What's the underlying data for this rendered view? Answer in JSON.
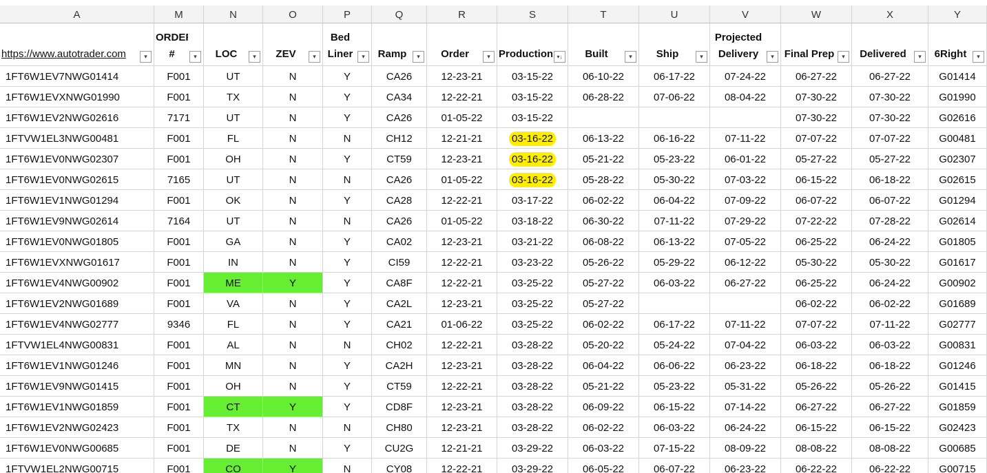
{
  "column_letters": [
    "A",
    "M",
    "N",
    "O",
    "P",
    "Q",
    "R",
    "S",
    "T",
    "U",
    "V",
    "W",
    "X",
    "Y"
  ],
  "headers": [
    "https://www.autotrader.com",
    "ORDER\n#",
    "LOC",
    "ZEV",
    "Bed\nLiner",
    "Ramp",
    "Order",
    "Production",
    "Built",
    "Ship",
    "Projected\nDelivery",
    "Final Prep",
    "Delivered",
    "6Right"
  ],
  "filter_icons": [
    "filter-dropdown-icon",
    "sort-filter-icon"
  ],
  "rows": [
    {
      "vin": "1FT6W1EV7NWG01414",
      "order_num": "F001",
      "loc": "UT",
      "zev": "N",
      "bed": "Y",
      "ramp": "CA26",
      "order": "12-23-21",
      "production": "03-15-22",
      "built": "06-10-22",
      "ship": "06-17-22",
      "projected": "07-24-22",
      "final_prep": "06-27-22",
      "delivered": "06-27-22",
      "right6": "G01414"
    },
    {
      "vin": "1FT6W1EVXNWG01990",
      "order_num": "F001",
      "loc": "TX",
      "zev": "N",
      "bed": "Y",
      "ramp": "CA34",
      "order": "12-22-21",
      "production": "03-15-22",
      "built": "06-28-22",
      "ship": "07-06-22",
      "projected": "08-04-22",
      "final_prep": "07-30-22",
      "delivered": "07-30-22",
      "right6": "G01990"
    },
    {
      "vin": "1FT6W1EV2NWG02616",
      "order_num": "7171",
      "loc": "UT",
      "zev": "N",
      "bed": "Y",
      "ramp": "CA26",
      "order": "01-05-22",
      "production": "03-15-22",
      "built": "",
      "ship": "",
      "projected": "",
      "final_prep": "07-30-22",
      "delivered": "07-30-22",
      "right6": "G02616"
    },
    {
      "vin": "1FTVW1EL3NWG00481",
      "order_num": "F001",
      "loc": "FL",
      "zev": "N",
      "bed": "N",
      "ramp": "CH12",
      "order": "12-21-21",
      "production": "03-16-22",
      "built": "06-13-22",
      "ship": "06-16-22",
      "projected": "07-11-22",
      "final_prep": "07-07-22",
      "delivered": "07-07-22",
      "right6": "G00481",
      "hl_production": true
    },
    {
      "vin": "1FT6W1EV0NWG02307",
      "order_num": "F001",
      "loc": "OH",
      "zev": "N",
      "bed": "Y",
      "ramp": "CT59",
      "order": "12-23-21",
      "production": "03-16-22",
      "built": "05-21-22",
      "ship": "05-23-22",
      "projected": "06-01-22",
      "final_prep": "05-27-22",
      "delivered": "05-27-22",
      "right6": "G02307",
      "hl_production": true
    },
    {
      "vin": "1FT6W1EV0NWG02615",
      "order_num": "7165",
      "loc": "UT",
      "zev": "N",
      "bed": "N",
      "ramp": "CA26",
      "order": "01-05-22",
      "production": "03-16-22",
      "built": "05-28-22",
      "ship": "05-30-22",
      "projected": "07-03-22",
      "final_prep": "06-15-22",
      "delivered": "06-18-22",
      "right6": "G02615",
      "hl_production": true
    },
    {
      "vin": "1FT6W1EV1NWG01294",
      "order_num": "F001",
      "loc": "OK",
      "zev": "N",
      "bed": "Y",
      "ramp": "CA28",
      "order": "12-22-21",
      "production": "03-17-22",
      "built": "06-02-22",
      "ship": "06-04-22",
      "projected": "07-09-22",
      "final_prep": "06-07-22",
      "delivered": "06-07-22",
      "right6": "G01294"
    },
    {
      "vin": "1FT6W1EV9NWG02614",
      "order_num": "7164",
      "loc": "UT",
      "zev": "N",
      "bed": "N",
      "ramp": "CA26",
      "order": "01-05-22",
      "production": "03-18-22",
      "built": "06-30-22",
      "ship": "07-11-22",
      "projected": "07-29-22",
      "final_prep": "07-22-22",
      "delivered": "07-28-22",
      "right6": "G02614"
    },
    {
      "vin": "1FT6W1EV0NWG01805",
      "order_num": "F001",
      "loc": "GA",
      "zev": "N",
      "bed": "Y",
      "ramp": "CA02",
      "order": "12-23-21",
      "production": "03-21-22",
      "built": "06-08-22",
      "ship": "06-13-22",
      "projected": "07-05-22",
      "final_prep": "06-25-22",
      "delivered": "06-24-22",
      "right6": "G01805"
    },
    {
      "vin": "1FT6W1EVXNWG01617",
      "order_num": "F001",
      "loc": "IN",
      "zev": "N",
      "bed": "Y",
      "ramp": "CI59",
      "order": "12-22-21",
      "production": "03-23-22",
      "built": "05-26-22",
      "ship": "05-29-22",
      "projected": "06-12-22",
      "final_prep": "05-30-22",
      "delivered": "05-30-22",
      "right6": "G01617"
    },
    {
      "vin": "1FT6W1EV4NWG00902",
      "order_num": "F001",
      "loc": "ME",
      "zev": "Y",
      "bed": "Y",
      "ramp": "CA8F",
      "order": "12-22-21",
      "production": "03-25-22",
      "built": "05-27-22",
      "ship": "06-03-22",
      "projected": "06-27-22",
      "final_prep": "06-25-22",
      "delivered": "06-24-22",
      "right6": "G00902",
      "green": true
    },
    {
      "vin": "1FT6W1EV2NWG01689",
      "order_num": "F001",
      "loc": "VA",
      "zev": "N",
      "bed": "Y",
      "ramp": "CA2L",
      "order": "12-23-21",
      "production": "03-25-22",
      "built": "05-27-22",
      "ship": "",
      "projected": "",
      "final_prep": "06-02-22",
      "delivered": "06-02-22",
      "right6": "G01689"
    },
    {
      "vin": "1FT6W1EV4NWG02777",
      "order_num": "9346",
      "loc": "FL",
      "zev": "N",
      "bed": "Y",
      "ramp": "CA21",
      "order": "01-06-22",
      "production": "03-25-22",
      "built": "06-02-22",
      "ship": "06-17-22",
      "projected": "07-11-22",
      "final_prep": "07-07-22",
      "delivered": "07-11-22",
      "right6": "G02777"
    },
    {
      "vin": "1FTVW1EL4NWG00831",
      "order_num": "F001",
      "loc": "AL",
      "zev": "N",
      "bed": "N",
      "ramp": "CH02",
      "order": "12-22-21",
      "production": "03-28-22",
      "built": "05-20-22",
      "ship": "05-24-22",
      "projected": "07-04-22",
      "final_prep": "06-03-22",
      "delivered": "06-03-22",
      "right6": "G00831"
    },
    {
      "vin": "1FT6W1EV1NWG01246",
      "order_num": "F001",
      "loc": "MN",
      "zev": "N",
      "bed": "Y",
      "ramp": "CA2H",
      "order": "12-23-21",
      "production": "03-28-22",
      "built": "06-04-22",
      "ship": "06-06-22",
      "projected": "06-23-22",
      "final_prep": "06-18-22",
      "delivered": "06-18-22",
      "right6": "G01246"
    },
    {
      "vin": "1FT6W1EV9NWG01415",
      "order_num": "F001",
      "loc": "OH",
      "zev": "N",
      "bed": "Y",
      "ramp": "CT59",
      "order": "12-22-21",
      "production": "03-28-22",
      "built": "05-21-22",
      "ship": "05-23-22",
      "projected": "05-31-22",
      "final_prep": "05-26-22",
      "delivered": "05-26-22",
      "right6": "G01415"
    },
    {
      "vin": "1FT6W1EV1NWG01859",
      "order_num": "F001",
      "loc": "CT",
      "zev": "Y",
      "bed": "Y",
      "ramp": "CD8F",
      "order": "12-23-21",
      "production": "03-28-22",
      "built": "06-09-22",
      "ship": "06-15-22",
      "projected": "07-14-22",
      "final_prep": "06-27-22",
      "delivered": "06-27-22",
      "right6": "G01859",
      "green": true
    },
    {
      "vin": "1FT6W1EV2NWG02423",
      "order_num": "F001",
      "loc": "TX",
      "zev": "N",
      "bed": "N",
      "ramp": "CH80",
      "order": "12-23-21",
      "production": "03-28-22",
      "built": "06-02-22",
      "ship": "06-03-22",
      "projected": "06-24-22",
      "final_prep": "06-15-22",
      "delivered": "06-15-22",
      "right6": "G02423"
    },
    {
      "vin": "1FT6W1EV0NWG00685",
      "order_num": "F001",
      "loc": "DE",
      "zev": "N",
      "bed": "Y",
      "ramp": "CU2G",
      "order": "12-21-21",
      "production": "03-29-22",
      "built": "06-03-22",
      "ship": "07-15-22",
      "projected": "08-09-22",
      "final_prep": "08-08-22",
      "delivered": "08-08-22",
      "right6": "G00685"
    },
    {
      "vin": "1FTVW1EL2NWG00715",
      "order_num": "F001",
      "loc": "CO",
      "zev": "Y",
      "bed": "N",
      "ramp": "CY08",
      "order": "12-22-21",
      "production": "03-29-22",
      "built": "06-05-22",
      "ship": "06-07-22",
      "projected": "06-23-22",
      "final_prep": "06-22-22",
      "delivered": "06-22-22",
      "right6": "G00715",
      "green": true
    }
  ],
  "colors": {
    "zev_highlight": "#66ee33",
    "production_highlight": "#ffee00",
    "grid": "#d4d4d4",
    "header_bg": "#f3f3f3"
  }
}
